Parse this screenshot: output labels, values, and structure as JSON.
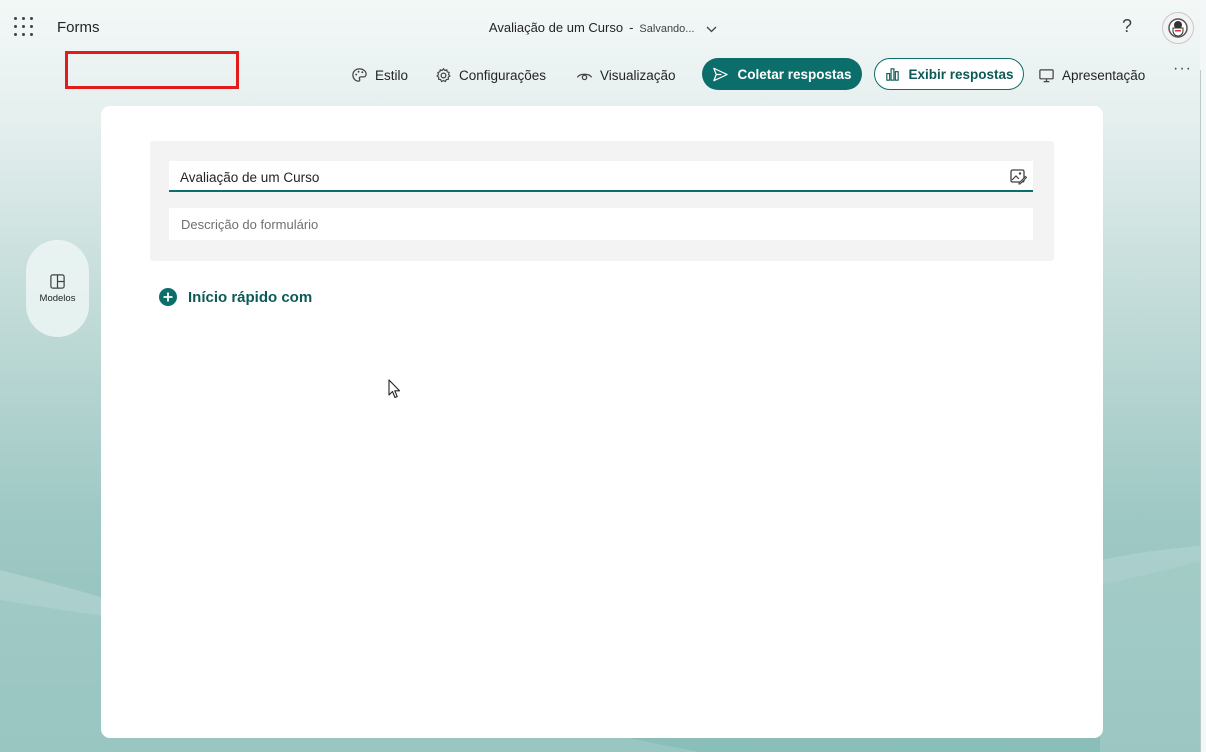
{
  "app": {
    "name": "Forms"
  },
  "document": {
    "title": "Avaliação de um Curso",
    "separator": "-",
    "status": "Salvando..."
  },
  "topbar": {
    "help": "?"
  },
  "toolbar": {
    "style": "Estilo",
    "settings": "Configurações",
    "preview": "Visualização",
    "collect": "Coletar respostas",
    "view_responses": "Exibir respostas",
    "present": "Apresentação",
    "more": "···"
  },
  "sidebar": {
    "templates": "Modelos"
  },
  "form": {
    "title": "Avaliação de um Curso",
    "description_placeholder": "Descrição do formulário",
    "description_value": ""
  },
  "quick_start": {
    "label": "Início rápido com"
  },
  "colors": {
    "accent": "#0c6e6a",
    "highlight": "#e21b1b"
  },
  "icons": {
    "app_launcher": "waffle-icon",
    "style": "palette-icon",
    "settings": "gear-icon",
    "preview": "eye-icon",
    "collect": "send-icon",
    "view_responses": "bar-chart-icon",
    "present": "monitor-icon",
    "templates": "layout-icon",
    "title_image": "image-edit-icon",
    "quick_start": "plus-circle-icon"
  }
}
